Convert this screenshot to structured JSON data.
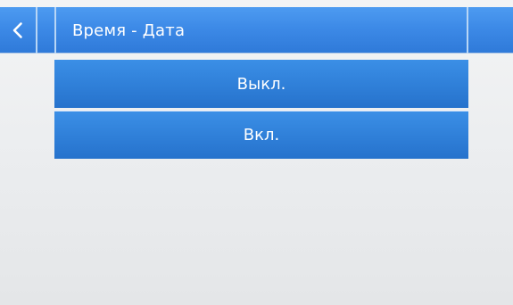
{
  "header": {
    "title": "Время - Дата",
    "back_icon": "chevron-left-icon"
  },
  "options": [
    {
      "label": "Выкл."
    },
    {
      "label": "Вкл."
    }
  ],
  "colors": {
    "accent": "#2f7fd8",
    "header": "#3d8ae7",
    "background": "#eceef0",
    "text": "#ffffff"
  }
}
